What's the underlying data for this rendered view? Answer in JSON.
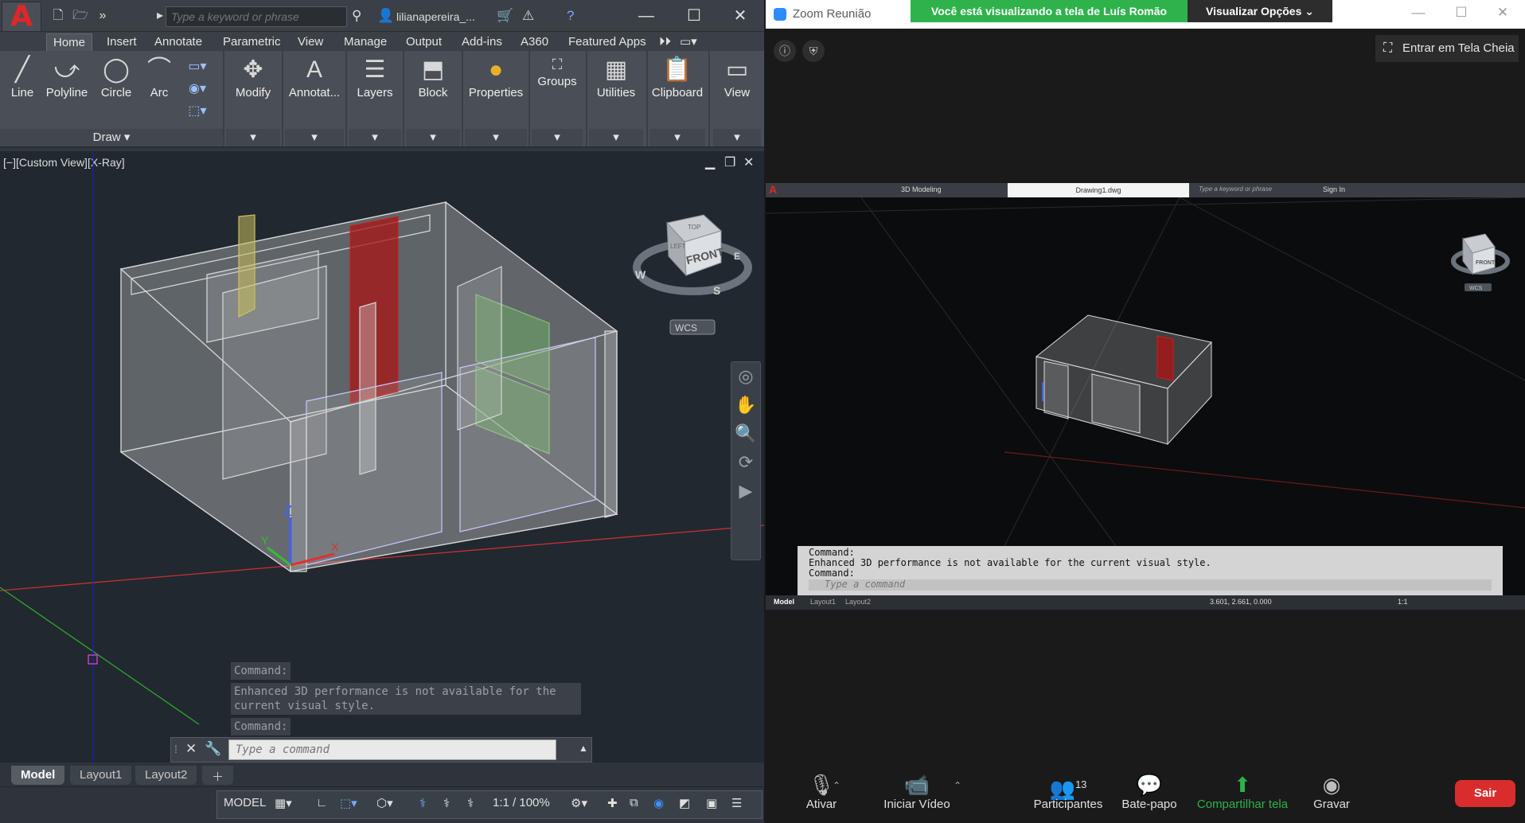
{
  "autocad": {
    "search_placeholder": "Type a keyword or phrase",
    "user_name": "lilianapereira_...",
    "tabs": [
      "Home",
      "Insert",
      "Annotate",
      "Parametric",
      "View",
      "Manage",
      "Output",
      "Add-ins",
      "A360",
      "Featured Apps"
    ],
    "draw_tools": {
      "line": "Line",
      "polyline": "Polyline",
      "circle": "Circle",
      "arc": "Arc"
    },
    "draw_panel": "Draw",
    "panels": {
      "modify": "Modify",
      "annotation": "Annotat...",
      "layers": "Layers",
      "block": "Block",
      "properties": "Properties",
      "groups": "Groups",
      "utilities": "Utilities",
      "clipboard": "Clipboard",
      "view": "View"
    },
    "viewport_label": "[−][Custom View][X-Ray]",
    "viewcube": {
      "face": "FRONT",
      "top": "TOP",
      "left": "LEFT",
      "compass_w": "W",
      "compass_s": "S",
      "compass_e": "E",
      "ucs": "WCS"
    },
    "axis_labels": {
      "z": "Z",
      "x": "X",
      "y": "Y"
    },
    "command_history": [
      "Command:",
      "Enhanced 3D performance is not available for the current visual style.",
      "Command:"
    ],
    "command_placeholder": "Type a command",
    "layout_tabs": [
      "Model",
      "Layout1",
      "Layout2"
    ],
    "status": {
      "model": "MODEL",
      "scale": "1:1 / 100%"
    }
  },
  "zoom": {
    "app_title": "Zoom Reunião",
    "share_banner": "Você está visualizando a tela de Luís Romão",
    "view_options": "Visualizar Opções",
    "fullscreen": "Entrar em Tela Cheia",
    "shared": {
      "workspace": "3D Modeling",
      "doc_title": "Drawing1.dwg",
      "search": "Type a keyword or phrase",
      "sign_in": "Sign In",
      "command_lines": [
        "Command:",
        "Enhanced 3D performance is not available for the current visual style.",
        "Command:"
      ],
      "command_placeholder": "Type a command",
      "tabs": [
        "Model",
        "Layout1",
        "Layout2"
      ],
      "coords": "3.601, 2.661, 0.000",
      "scale": "1:1",
      "ucs": "WCS",
      "viewcube_face": "FRONT"
    },
    "controls": {
      "mute": "Ativar",
      "video": "Iniciar Vídeo",
      "participants": "Participantes",
      "participants_count": "13",
      "chat": "Bate-papo",
      "share": "Compartilhar tela",
      "record": "Gravar",
      "leave": "Sair"
    },
    "share_color": "#2fb24c",
    "leave_color": "#d92d2d"
  }
}
